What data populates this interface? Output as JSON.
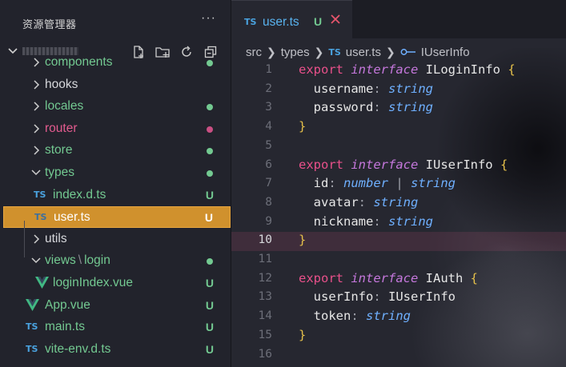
{
  "sidebar": {
    "title": "资源管理器",
    "more": "···",
    "tree": [
      {
        "label": "components",
        "kind": "folder",
        "expanded": false,
        "color": "#73c991",
        "badge": "dot",
        "badge_color": "#73c991"
      },
      {
        "label": "hooks",
        "kind": "folder",
        "expanded": false,
        "color": "#d7d8dc",
        "badge": "",
        "badge_color": ""
      },
      {
        "label": "locales",
        "kind": "folder",
        "expanded": false,
        "color": "#73c991",
        "badge": "dot",
        "badge_color": "#73c991"
      },
      {
        "label": "router",
        "kind": "folder",
        "expanded": false,
        "color": "#e35b8f",
        "badge": "dot",
        "badge_color": "#c94f83"
      },
      {
        "label": "store",
        "kind": "folder",
        "expanded": false,
        "color": "#73c991",
        "badge": "dot",
        "badge_color": "#73c991"
      },
      {
        "label": "types",
        "kind": "folder",
        "expanded": true,
        "color": "#73c991",
        "badge": "dot",
        "badge_color": "#73c991"
      },
      {
        "label": "index.d.ts",
        "kind": "ts",
        "color": "#73c991",
        "badge": "U",
        "badge_color": "#73c991"
      },
      {
        "label": "user.ts",
        "kind": "ts",
        "selected": true,
        "color": "#ffffff",
        "badge": "U",
        "badge_color": "#ffffff"
      },
      {
        "label": "utils",
        "kind": "folder",
        "expanded": false,
        "color": "#d7d8dc",
        "badge": "",
        "badge_color": ""
      },
      {
        "label": "views",
        "label2": "login",
        "kind": "folder",
        "expanded": true,
        "color": "#73c991",
        "badge": "dot",
        "badge_color": "#73c991"
      },
      {
        "label": "loginIndex.vue",
        "kind": "vue",
        "color": "#73c991",
        "badge": "U",
        "badge_color": "#73c991"
      },
      {
        "label": "App.vue",
        "kind": "vue",
        "color": "#73c991",
        "badge": "U",
        "badge_color": "#73c991"
      },
      {
        "label": "main.ts",
        "kind": "ts",
        "color": "#73c991",
        "badge": "U",
        "badge_color": "#73c991"
      },
      {
        "label": "vite-env.d.ts",
        "kind": "ts",
        "color": "#73c991",
        "badge": "U",
        "badge_color": "#73c991"
      }
    ]
  },
  "tab": {
    "icon": "TS",
    "name": "user.ts",
    "status": "U"
  },
  "breadcrumb": {
    "items": [
      "src",
      "types",
      "user.ts",
      "IUserInfo"
    ],
    "file_icon": "TS"
  },
  "code": {
    "active_line": 10,
    "lines": [
      {
        "n": "1",
        "tokens": [
          [
            "k",
            "export "
          ],
          [
            "i",
            "interface "
          ],
          [
            "n",
            "ILoginInfo "
          ],
          [
            "b",
            "{"
          ]
        ]
      },
      {
        "n": "2",
        "tokens": [
          [
            "n",
            "  username"
          ],
          [
            "p",
            ": "
          ],
          [
            "t",
            "string"
          ]
        ]
      },
      {
        "n": "3",
        "tokens": [
          [
            "n",
            "  password"
          ],
          [
            "p",
            ": "
          ],
          [
            "t",
            "string"
          ]
        ]
      },
      {
        "n": "4",
        "tokens": [
          [
            "b",
            "}"
          ]
        ]
      },
      {
        "n": "5",
        "tokens": []
      },
      {
        "n": "6",
        "tokens": [
          [
            "k",
            "export "
          ],
          [
            "i",
            "interface "
          ],
          [
            "n",
            "IUserInfo "
          ],
          [
            "b",
            "{"
          ]
        ]
      },
      {
        "n": "7",
        "tokens": [
          [
            "n",
            "  id"
          ],
          [
            "p",
            ": "
          ],
          [
            "t",
            "number "
          ],
          [
            "p",
            "| "
          ],
          [
            "t",
            "string"
          ]
        ]
      },
      {
        "n": "8",
        "tokens": [
          [
            "n",
            "  avatar"
          ],
          [
            "p",
            ": "
          ],
          [
            "t",
            "string"
          ]
        ]
      },
      {
        "n": "9",
        "tokens": [
          [
            "n",
            "  nickname"
          ],
          [
            "p",
            ": "
          ],
          [
            "t",
            "string"
          ]
        ]
      },
      {
        "n": "10",
        "tokens": [
          [
            "b",
            "}"
          ]
        ]
      },
      {
        "n": "11",
        "tokens": []
      },
      {
        "n": "12",
        "tokens": [
          [
            "k",
            "export "
          ],
          [
            "i",
            "interface "
          ],
          [
            "n",
            "IAuth "
          ],
          [
            "b",
            "{"
          ]
        ]
      },
      {
        "n": "13",
        "tokens": [
          [
            "n",
            "  userInfo"
          ],
          [
            "p",
            ": "
          ],
          [
            "n",
            "IUserInfo"
          ]
        ]
      },
      {
        "n": "14",
        "tokens": [
          [
            "n",
            "  token"
          ],
          [
            "p",
            ": "
          ],
          [
            "t",
            "string"
          ]
        ]
      },
      {
        "n": "15",
        "tokens": [
          [
            "b",
            "}"
          ]
        ]
      },
      {
        "n": "16",
        "tokens": []
      }
    ]
  }
}
